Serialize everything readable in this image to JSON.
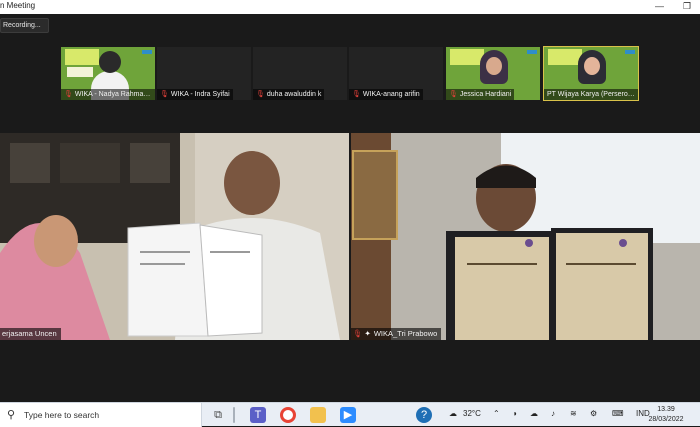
{
  "window": {
    "title": "n Meeting",
    "minimize_glyph": "—",
    "restore_glyph": "❐"
  },
  "recording": {
    "label": "Recording..."
  },
  "participants_strip": [
    {
      "name": "WIKA - Nadya Rahmas...",
      "muted": true,
      "video": true,
      "style": "banner-woman"
    },
    {
      "name": "WIKA - Indra Syifai",
      "muted": true,
      "video": false
    },
    {
      "name": "duha awaluddin k",
      "muted": true,
      "video": false
    },
    {
      "name": "WIKA-anang arifin",
      "muted": true,
      "video": false
    },
    {
      "name": "Jessica Hardiani",
      "muted": true,
      "video": true,
      "style": "banner-hijab"
    },
    {
      "name": "PT Wijaya Karya (Persero)...",
      "muted": false,
      "video": true,
      "style": "banner-hijab",
      "active": true
    }
  ],
  "main_tiles": {
    "left": {
      "name": "erjasama Uncen",
      "muted": false
    },
    "right": {
      "name": "WIKA_Tri Prabowo",
      "muted": true,
      "pinned": true
    }
  },
  "taskbar": {
    "search_placeholder": "Type here to search",
    "weather": "32°C",
    "language": "IND",
    "time": "13.39",
    "date": "28/03/2022"
  },
  "colors": {
    "meeting_bg": "#1a1a1a",
    "mute_red": "#e0403a",
    "active_border": "#d9c24a",
    "thumb_banner_green": "#6fa43a"
  }
}
